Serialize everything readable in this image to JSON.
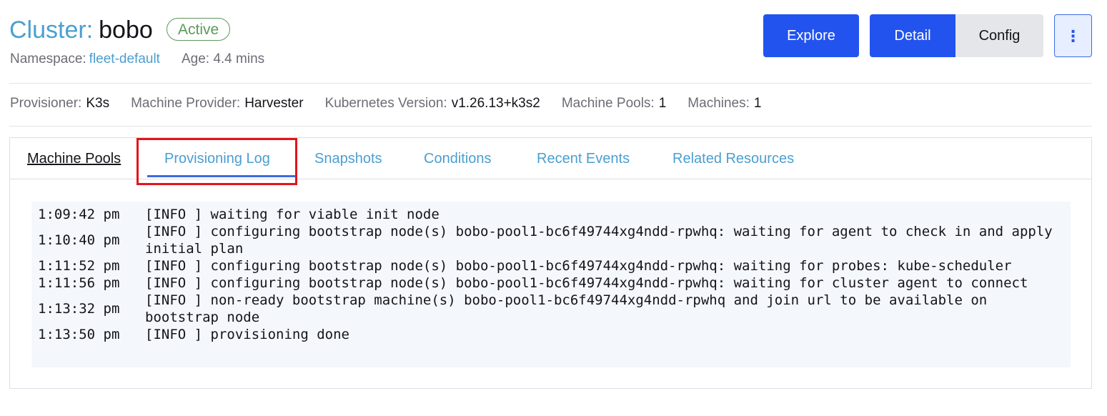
{
  "header": {
    "title_prefix": "Cluster:",
    "cluster_name": "bobo",
    "status": "Active",
    "namespace_label": "Namespace:",
    "namespace_value": "fleet-default",
    "age_text": "Age: 4.4 mins"
  },
  "actions": {
    "explore": "Explore",
    "detail": "Detail",
    "config": "Config",
    "more": "⋮"
  },
  "details": [
    {
      "label": "Provisioner:",
      "value": "K3s"
    },
    {
      "label": "Machine Provider:",
      "value": "Harvester"
    },
    {
      "label": "Kubernetes Version:",
      "value": "v1.26.13+k3s2"
    },
    {
      "label": "Machine Pools:",
      "value": "1"
    },
    {
      "label": "Machines:",
      "value": "1"
    }
  ],
  "tabs": [
    {
      "label": "Machine Pools"
    },
    {
      "label": "Provisioning Log"
    },
    {
      "label": "Snapshots"
    },
    {
      "label": "Conditions"
    },
    {
      "label": "Recent Events"
    },
    {
      "label": "Related Resources"
    }
  ],
  "log": [
    {
      "time": "1:09:42 pm",
      "message": "[INFO ] waiting for viable init node"
    },
    {
      "time": "1:10:40 pm",
      "message": "[INFO ] configuring bootstrap node(s) bobo-pool1-bc6f49744xg4ndd-rpwhq: waiting for agent to check in and apply initial plan"
    },
    {
      "time": "1:11:52 pm",
      "message": "[INFO ] configuring bootstrap node(s) bobo-pool1-bc6f49744xg4ndd-rpwhq: waiting for probes: kube-scheduler"
    },
    {
      "time": "1:11:56 pm",
      "message": "[INFO ] configuring bootstrap node(s) bobo-pool1-bc6f49744xg4ndd-rpwhq: waiting for cluster agent to connect"
    },
    {
      "time": "1:13:32 pm",
      "message": "[INFO ] non-ready bootstrap machine(s) bobo-pool1-bc6f49744xg4ndd-rpwhq and join url to be available on bootstrap node"
    },
    {
      "time": "1:13:50 pm",
      "message": "[INFO ] provisioning done"
    }
  ],
  "colors": {
    "accent": "#2353ef",
    "link": "#4a9fd0",
    "active_status": "#5d995d",
    "highlight": "#e3141b"
  }
}
